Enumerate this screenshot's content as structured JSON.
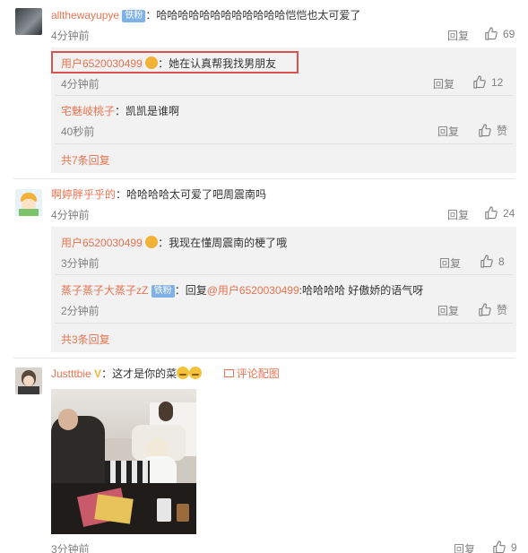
{
  "comments": [
    {
      "user": "allthewayupye",
      "badge": "铁粉",
      "text": "哈哈哈哈哈哈哈哈哈哈哈哈恺恺也太可爱了",
      "time": "4分钟前",
      "reply_label": "回复",
      "likes": "69",
      "replies": [
        {
          "user": "用户6520030499",
          "text": "她在认真帮我找男朋友",
          "time": "4分钟前",
          "reply_label": "回复",
          "likes": "12"
        },
        {
          "user": "宅魅岐桃子",
          "text": "凯凯是谁啊",
          "time": "40秒前",
          "reply_label": "回复",
          "likes": "赞"
        }
      ],
      "more": "共7条回复"
    },
    {
      "user": "啊婷胖乎乎的",
      "text": "哈哈哈哈太可爱了吧周震南吗",
      "time": "4分钟前",
      "reply_label": "回复",
      "likes": "24",
      "replies": [
        {
          "user": "用户6520030499",
          "text": "我现在懂周震南的梗了哦",
          "time": "3分钟前",
          "reply_label": "回复",
          "likes": "8"
        },
        {
          "user": "蒸子蒸子大蒸子zZ",
          "badge": "铁粉",
          "prefix": "回复",
          "mention": "@用户6520030499",
          "text": ":哈哈哈哈  好傲娇的语气呀",
          "time": "2分钟前",
          "reply_label": "回复",
          "likes": "赞"
        }
      ],
      "more": "共3条回复"
    },
    {
      "user": "Justttbie",
      "text": "这才是你的菜",
      "photo_link": "评论配图",
      "time": "3分钟前",
      "reply_label": "回复",
      "likes": "9"
    }
  ],
  "icons": {
    "like": "thumbs-up-icon",
    "medal": "medal-icon",
    "photo": "image-icon"
  },
  "colors": {
    "name": "#eb7350",
    "subbox": "#f2f2f2",
    "highlight": "#d9534f"
  }
}
